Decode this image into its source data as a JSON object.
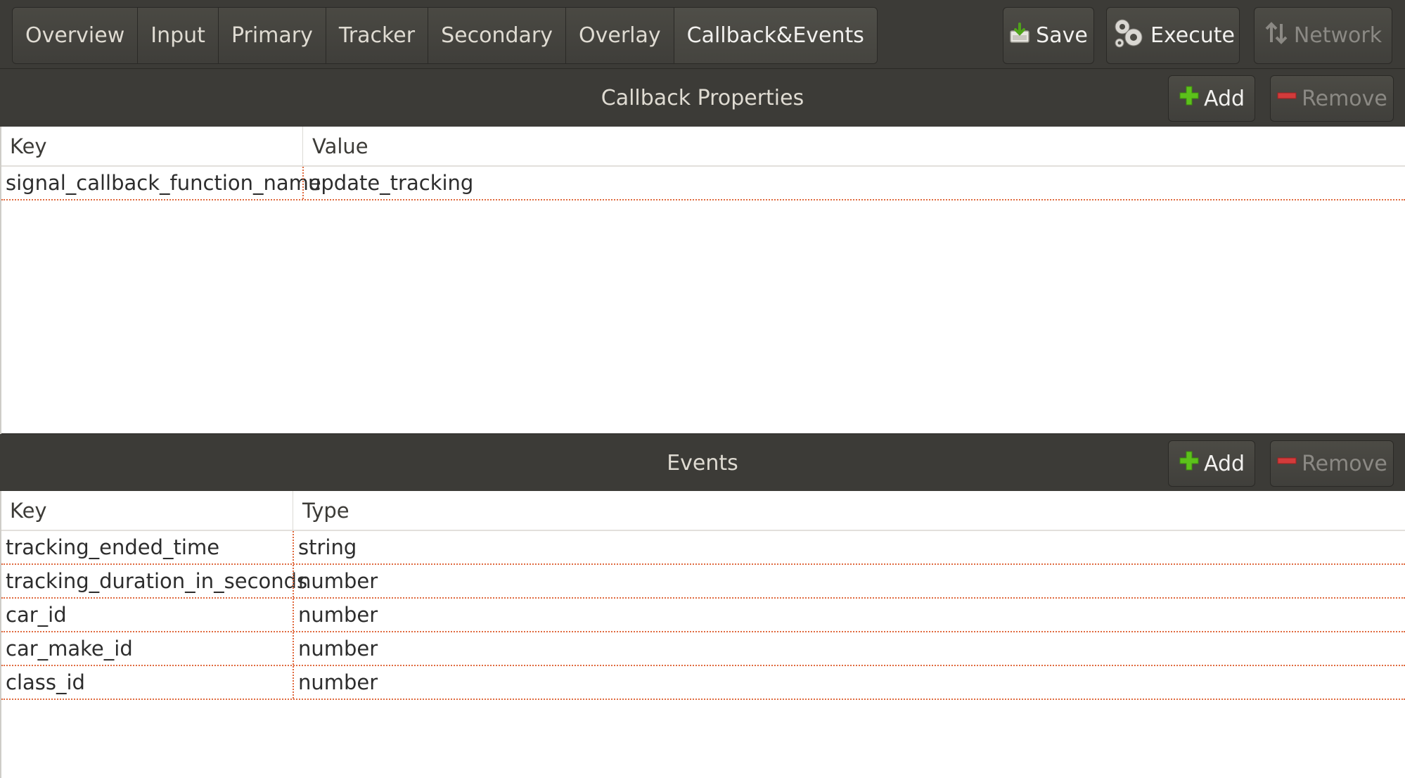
{
  "tabs": [
    "Overview",
    "Input",
    "Primary",
    "Tracker",
    "Secondary",
    "Overlay",
    "Callback&Events"
  ],
  "active_tab": "Callback&Events",
  "toolbar": {
    "save_label": "Save",
    "execute_label": "Execute",
    "network_label": "Network"
  },
  "callback": {
    "title": "Callback Properties",
    "add_label": "Add",
    "remove_label": "Remove",
    "col_key": "Key",
    "col_value": "Value",
    "rows": [
      {
        "key": "signal_callback_function_name",
        "value": "update_tracking"
      }
    ]
  },
  "events": {
    "title": "Events",
    "add_label": "Add",
    "remove_label": "Remove",
    "col_key": "Key",
    "col_type": "Type",
    "rows": [
      {
        "key": "tracking_ended_time",
        "type": "string"
      },
      {
        "key": "tracking_duration_in_seconds",
        "type": "number"
      },
      {
        "key": "car_id",
        "type": "number"
      },
      {
        "key": "car_make_id",
        "type": "number"
      },
      {
        "key": "class_id",
        "type": "number"
      }
    ]
  },
  "colors": {
    "toolbar_bg": "#3c3b37",
    "add_icon": "#5cc11b",
    "remove_icon": "#d23b3b",
    "row_separator": "#e06a3f"
  },
  "icons": {
    "save": "save-icon",
    "execute": "gears-icon",
    "network": "transfer-arrows-icon",
    "add": "plus-icon",
    "remove": "minus-icon"
  }
}
